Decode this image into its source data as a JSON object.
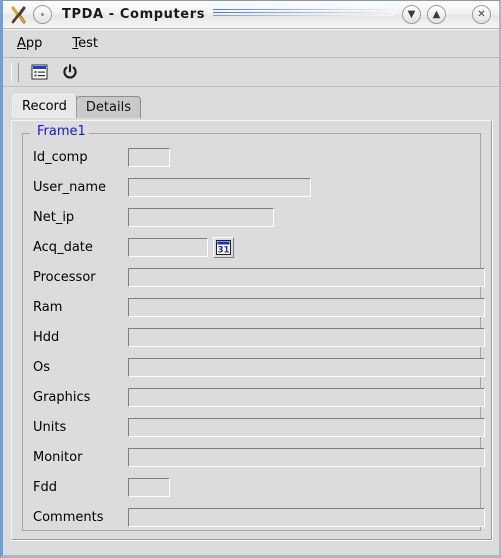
{
  "window": {
    "title": "TPDA - Computers",
    "app_icon": "x-app-icon",
    "system_menu_icon": "system-menu-icon",
    "controls": [
      {
        "name": "minimize-button",
        "icon": "chevron-down-icon",
        "glyph": "▼"
      },
      {
        "name": "maximize-button",
        "icon": "chevron-up-icon",
        "glyph": "▲"
      },
      {
        "name": "close-button",
        "icon": "close-x-icon",
        "glyph": "✕"
      }
    ]
  },
  "menubar": {
    "items": [
      {
        "name": "menu-app",
        "accel": "A",
        "rest": "pp"
      },
      {
        "name": "menu-test",
        "accel": "T",
        "rest": "est"
      }
    ]
  },
  "toolbar": {
    "buttons": [
      {
        "name": "record-list-button",
        "icon": "form-list-icon"
      },
      {
        "name": "quit-button",
        "icon": "power-icon"
      }
    ]
  },
  "tabs": [
    {
      "label": "Record",
      "active": true
    },
    {
      "label": "Details",
      "active": false
    }
  ],
  "form": {
    "group_label": "Frame1",
    "fields": [
      {
        "label": "Id_comp",
        "value": "",
        "size": "tiny",
        "calendar": false
      },
      {
        "label": "User_name",
        "value": "",
        "size": "user",
        "calendar": false
      },
      {
        "label": "Net_ip",
        "value": "",
        "size": "net",
        "calendar": false
      },
      {
        "label": "Acq_date",
        "value": "",
        "size": "date",
        "calendar": true
      },
      {
        "label": "Processor",
        "value": "",
        "size": "full",
        "calendar": false
      },
      {
        "label": "Ram",
        "value": "",
        "size": "full",
        "calendar": false
      },
      {
        "label": "Hdd",
        "value": "",
        "size": "full",
        "calendar": false
      },
      {
        "label": "Os",
        "value": "",
        "size": "full",
        "calendar": false
      },
      {
        "label": "Graphics",
        "value": "",
        "size": "full",
        "calendar": false
      },
      {
        "label": "Units",
        "value": "",
        "size": "full",
        "calendar": false
      },
      {
        "label": "Monitor",
        "value": "",
        "size": "full",
        "calendar": false
      },
      {
        "label": "Fdd",
        "value": "",
        "size": "tiny",
        "calendar": false
      },
      {
        "label": "Comments",
        "value": "",
        "size": "full",
        "calendar": false
      }
    ],
    "calendar_button": {
      "name": "calendar-picker-button",
      "icon": "calendar-icon",
      "day": "31"
    }
  },
  "colors": {
    "face": "#dcdcdc",
    "frame_label": "#1818d8",
    "window_border": "#7f9db9",
    "accent_blue": "#4f7fc0"
  }
}
